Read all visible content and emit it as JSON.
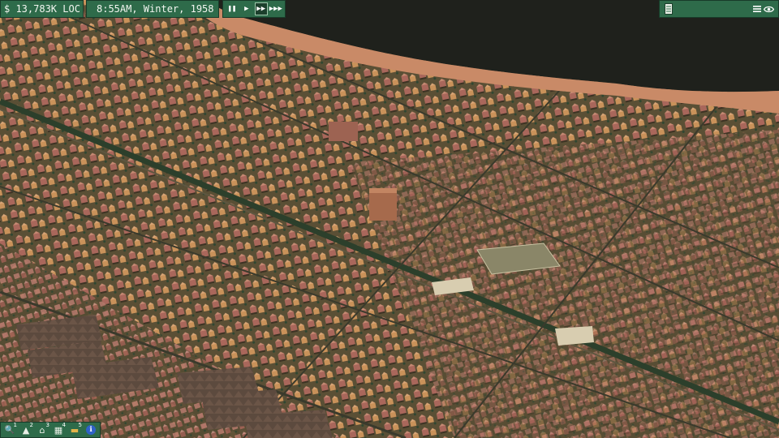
{
  "hud": {
    "money": "$ 13,783K LOC",
    "clock": "8:55AM, Winter, 1958",
    "speed": {
      "buttons": [
        {
          "icon": "pause-icon",
          "glyph": "❚❚",
          "active": false
        },
        {
          "icon": "play-icon",
          "glyph": "▶",
          "active": false
        },
        {
          "icon": "fast-forward-icon",
          "glyph": "▶▶",
          "active": true
        },
        {
          "icon": "fastest-forward-icon",
          "glyph": "▶▶▶",
          "active": false
        }
      ]
    },
    "menu": {
      "left_icon": "notebook-icon",
      "right_icons": [
        "menu-icon",
        "eye-icon"
      ]
    }
  },
  "toolbar": {
    "tools": [
      {
        "name": "zoom-tool",
        "icon": "magnifier-icon",
        "glyph": "🔍",
        "badge": "1"
      },
      {
        "name": "bulldoze-tool",
        "icon": "bulldozer-icon",
        "glyph": "▲",
        "badge": "2"
      },
      {
        "name": "zone-tool",
        "icon": "house-icon",
        "glyph": "⌂",
        "badge": "3"
      },
      {
        "name": "industry-tool",
        "icon": "factory-icon",
        "glyph": "▦",
        "badge": "4"
      },
      {
        "name": "transit-tool",
        "icon": "vehicle-icon",
        "glyph": "▬",
        "badge": "5"
      },
      {
        "name": "info-tool",
        "icon": "info-icon",
        "glyph": "ℹ",
        "badge": ""
      }
    ]
  },
  "colors": {
    "hud_green": "#2e6b4a",
    "hud_border": "#183b29",
    "shore": "#c98a67",
    "water": "#1f211c",
    "ground": "#5b5136",
    "roof_brick": "#a6665b",
    "roof_tan": "#c9925a",
    "factory_roof": "#5c4a3e",
    "trees": "#2f4630"
  }
}
